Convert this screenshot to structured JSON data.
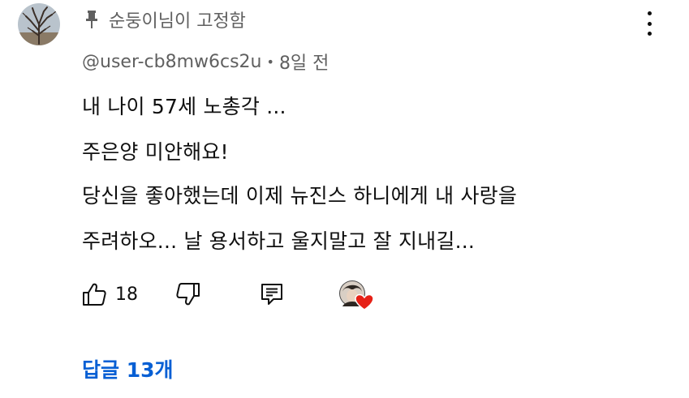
{
  "pinned": {
    "icon": "pin-icon",
    "text": "순둥이님이 고정함"
  },
  "author": {
    "handle": "@user-cb8mw6cs2u",
    "separator": "•",
    "time": "8일 전"
  },
  "comment": {
    "lines": [
      "내 나이 57세 노총각  ...",
      "주은양 미안해요!",
      "당신을 좋아했는데 이제 뉴진스 하니에게 내 사랑을",
      "주려하오... 날 용서하고 울지말고 잘 지내길..."
    ]
  },
  "actions": {
    "like_icon": "thumbs-up-icon",
    "like_count": "18",
    "dislike_icon": "thumbs-down-icon",
    "reply_icon": "reply-comment-icon",
    "creator_heart_icon": "creator-heart-icon",
    "heart_color": "#e62117"
  },
  "replies": {
    "label": "답글 13개",
    "color": "#065fd4"
  },
  "menu": {
    "icon": "more-vertical-icon"
  }
}
